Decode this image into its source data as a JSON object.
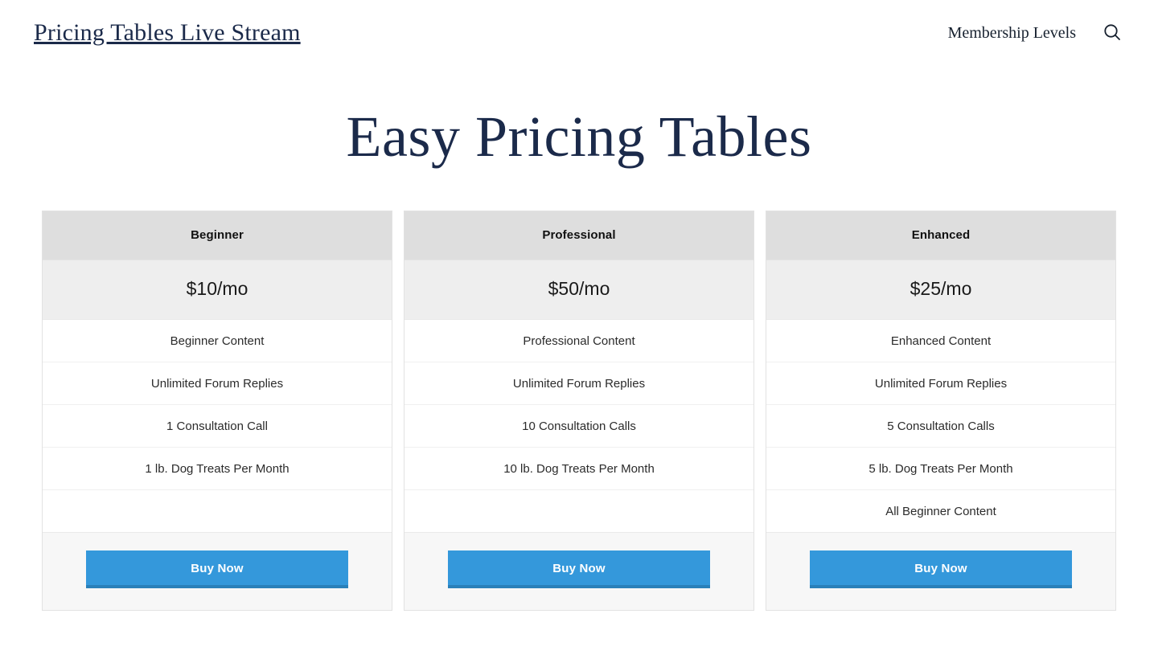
{
  "header": {
    "site_title": "Pricing Tables Live Stream",
    "nav_link": "Membership Levels",
    "search_icon": "search-icon"
  },
  "main": {
    "page_heading": "Easy Pricing Tables"
  },
  "colors": {
    "heading": "#1b2a4a",
    "button": "#3498db",
    "button_shadow": "#2a80b9",
    "header_band": "#dedede",
    "price_band": "#eeeeee",
    "footer_band": "#f7f7f7"
  },
  "pricing_columns": [
    {
      "name": "Beginner",
      "price": "$10/mo",
      "features": [
        "Beginner Content",
        "Unlimited Forum Replies",
        "1 Consultation Call",
        "1 lb. Dog Treats Per Month",
        ""
      ],
      "cta": "Buy Now"
    },
    {
      "name": "Professional",
      "price": "$50/mo",
      "features": [
        "Professional Content",
        "Unlimited Forum Replies",
        "10 Consultation Calls",
        "10 lb. Dog Treats Per Month",
        ""
      ],
      "cta": "Buy Now"
    },
    {
      "name": "Enhanced",
      "price": "$25/mo",
      "features": [
        "Enhanced Content",
        "Unlimited Forum Replies",
        "5 Consultation Calls",
        "5 lb. Dog Treats Per Month",
        "All Beginner Content"
      ],
      "cta": "Buy Now"
    }
  ]
}
